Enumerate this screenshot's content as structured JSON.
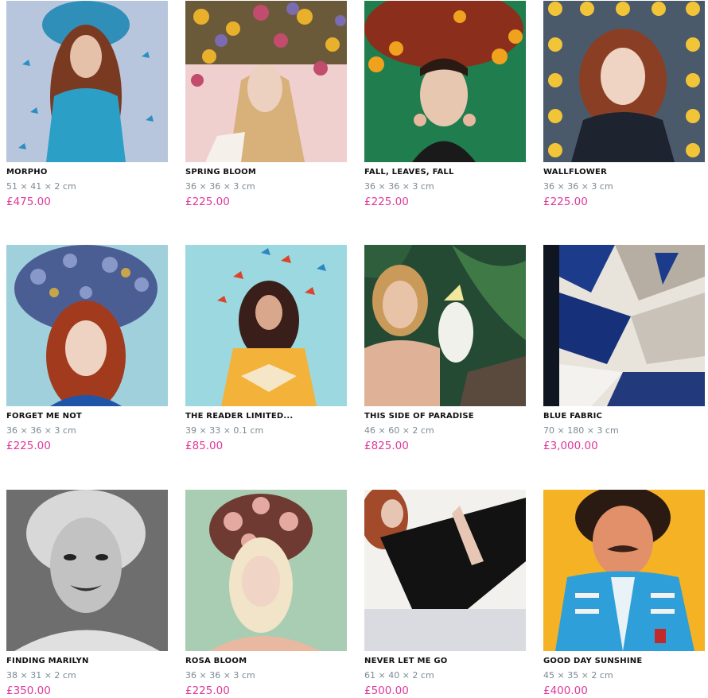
{
  "artworks": [
    {
      "title": "MORPHO",
      "dims": "51 × 41 × 2 cm",
      "price": "£475.00"
    },
    {
      "title": "SPRING BLOOM",
      "dims": "36 × 36 × 3 cm",
      "price": "£225.00"
    },
    {
      "title": "FALL, LEAVES, FALL",
      "dims": "36 × 36 × 3 cm",
      "price": "£225.00"
    },
    {
      "title": "WALLFLOWER",
      "dims": "36 × 36 × 3 cm",
      "price": "£225.00"
    },
    {
      "title": "FORGET ME NOT",
      "dims": "36 × 36 × 3 cm",
      "price": "£225.00"
    },
    {
      "title": "THE READER LIMITED...",
      "dims": "39 × 33 × 0.1 cm",
      "price": "£85.00"
    },
    {
      "title": "THIS SIDE OF PARADISE",
      "dims": "46 × 60 × 2 cm",
      "price": "£825.00"
    },
    {
      "title": "BLUE FABRIC",
      "dims": "70 × 180 × 3 cm",
      "price": "£3,000.00"
    },
    {
      "title": "FINDING MARILYN",
      "dims": "38 × 31 × 2 cm",
      "price": "£350.00"
    },
    {
      "title": "ROSA BLOOM",
      "dims": "36 × 36 × 3 cm",
      "price": "£225.00"
    },
    {
      "title": "NEVER LET ME GO",
      "dims": "61 × 40 × 2 cm",
      "price": "£500.00"
    },
    {
      "title": "GOOD DAY SUNSHINE",
      "dims": "45 × 35 × 2 cm",
      "price": "£400.00"
    }
  ]
}
